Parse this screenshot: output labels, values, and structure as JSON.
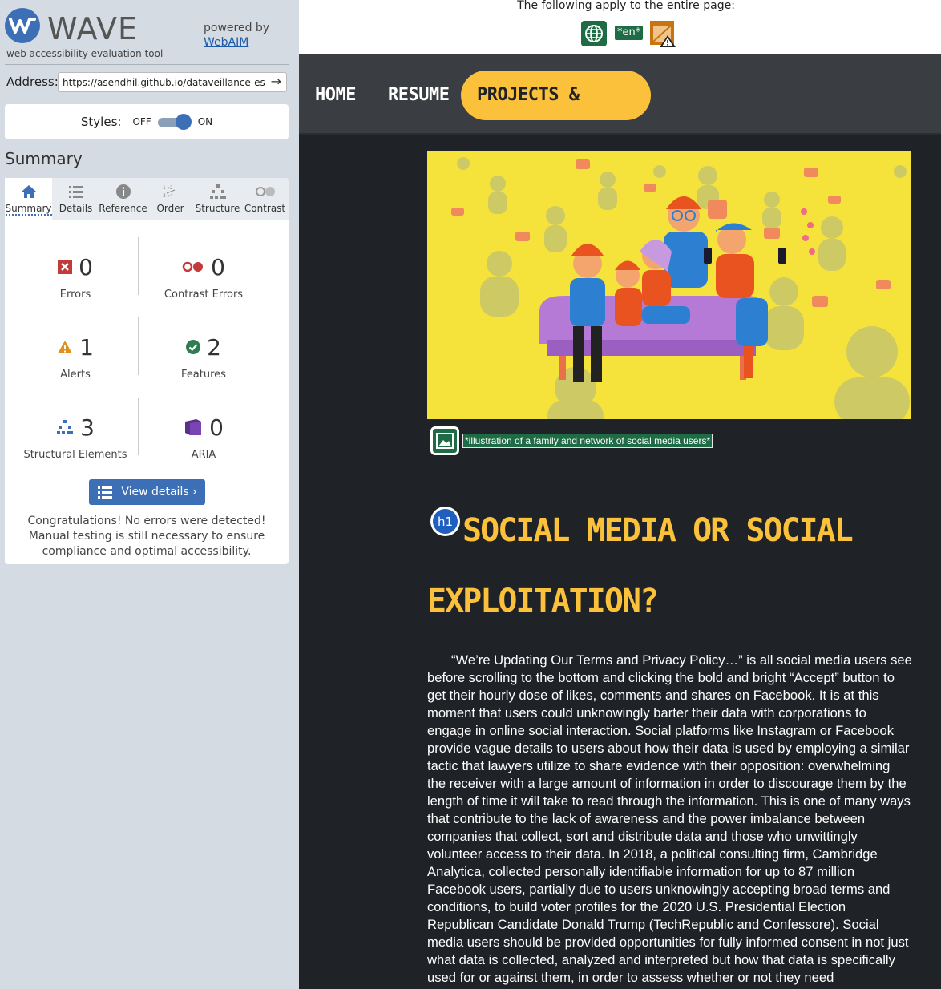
{
  "wave": {
    "logo_text": "WAVE",
    "tagline": "web accessibility evaluation tool",
    "powered_by": "powered by",
    "webaim_link": "WebAIM",
    "address_label": "Address:",
    "address_value": "https://asendhil.github.io/dataveillance-essay/",
    "styles_label": "Styles:",
    "styles_off": "OFF",
    "styles_on": "ON",
    "styles_enabled": true,
    "summary_title": "Summary",
    "tabs": [
      {
        "label": "Summary",
        "icon": "home-icon",
        "active": true
      },
      {
        "label": "Details",
        "icon": "list-icon",
        "active": false
      },
      {
        "label": "Reference",
        "icon": "info-icon",
        "active": false
      },
      {
        "label": "Order",
        "icon": "order-icon",
        "active": false
      },
      {
        "label": "Structure",
        "icon": "structure-icon",
        "active": false
      },
      {
        "label": "Contrast",
        "icon": "contrast-icon",
        "active": false
      }
    ],
    "stats": [
      {
        "label": "Errors",
        "value": "0",
        "icon": "error-icon",
        "color": "#c23b3b"
      },
      {
        "label": "Contrast Errors",
        "value": "0",
        "icon": "contrast-error-icon",
        "color": "#c23b3b"
      },
      {
        "label": "Alerts",
        "value": "1",
        "icon": "alert-icon",
        "color": "#e0901c"
      },
      {
        "label": "Features",
        "value": "2",
        "icon": "feature-icon",
        "color": "#2e7d52"
      },
      {
        "label": "Structural Elements",
        "value": "3",
        "icon": "structural-icon",
        "color": "#3d6fb6"
      },
      {
        "label": "ARIA",
        "value": "0",
        "icon": "aria-icon",
        "color": "#5b2f8a"
      }
    ],
    "view_details": "View details ›",
    "congrats": "Congratulations! No errors were detected! Manual testing is still necessary to ensure compliance and optimal accessibility."
  },
  "page_top": {
    "apply_text": "The following apply to the entire page:",
    "lang_badge": "*en*"
  },
  "site": {
    "nav": [
      "HOME",
      "RESUME",
      "PROJECTS & RESEARCH"
    ],
    "active_nav": "PROJECTS & RESEARCH",
    "caption": "*illustration of a family and network of social media users*",
    "h1_badge": "h1",
    "headline": "SOCIAL MEDIA OR SOCIAL EXPLOITATION?",
    "body": "“We’re Updating Our Terms and Privacy Policy…” is all social media users see before scrolling to the bottom and clicking the bold and bright “Accept” button to get their hourly dose of likes, comments and shares on Facebook. It is at this moment that users could unknowingly barter their data with corporations to engage in online social interaction. Social platforms like Instagram or Facebook provide vague details to users about how their data is used by employing a similar tactic that lawyers utilize to share evidence with their opposition: overwhelming the receiver with a large amount of information in order to discourage them by the length of time it will take to read through the information. This is one of many ways that contribute to the lack of awareness and the power imbalance between companies that collect, sort and distribute data and those who unwittingly volunteer access to their data. In 2018, a political consulting firm, Cambridge Analytica, collected personally identifiable information for up to 87 million Facebook users, partially due to users unknowingly accepting broad terms and conditions, to build voter profiles for the 2020 U.S. Presidential Election Republican Candidate Donald Trump (TechRepublic and Confessore). Social media users should be provided opportunities for fully informed consent in not just what data is collected, analyzed and interpreted but how that data is specifically used for or against them, in order to assess whether or not they need",
    "colors": {
      "accent": "#fcc13b",
      "background": "#1f2226",
      "nav": "#3a3d42",
      "hero": "#f5e23a"
    }
  }
}
